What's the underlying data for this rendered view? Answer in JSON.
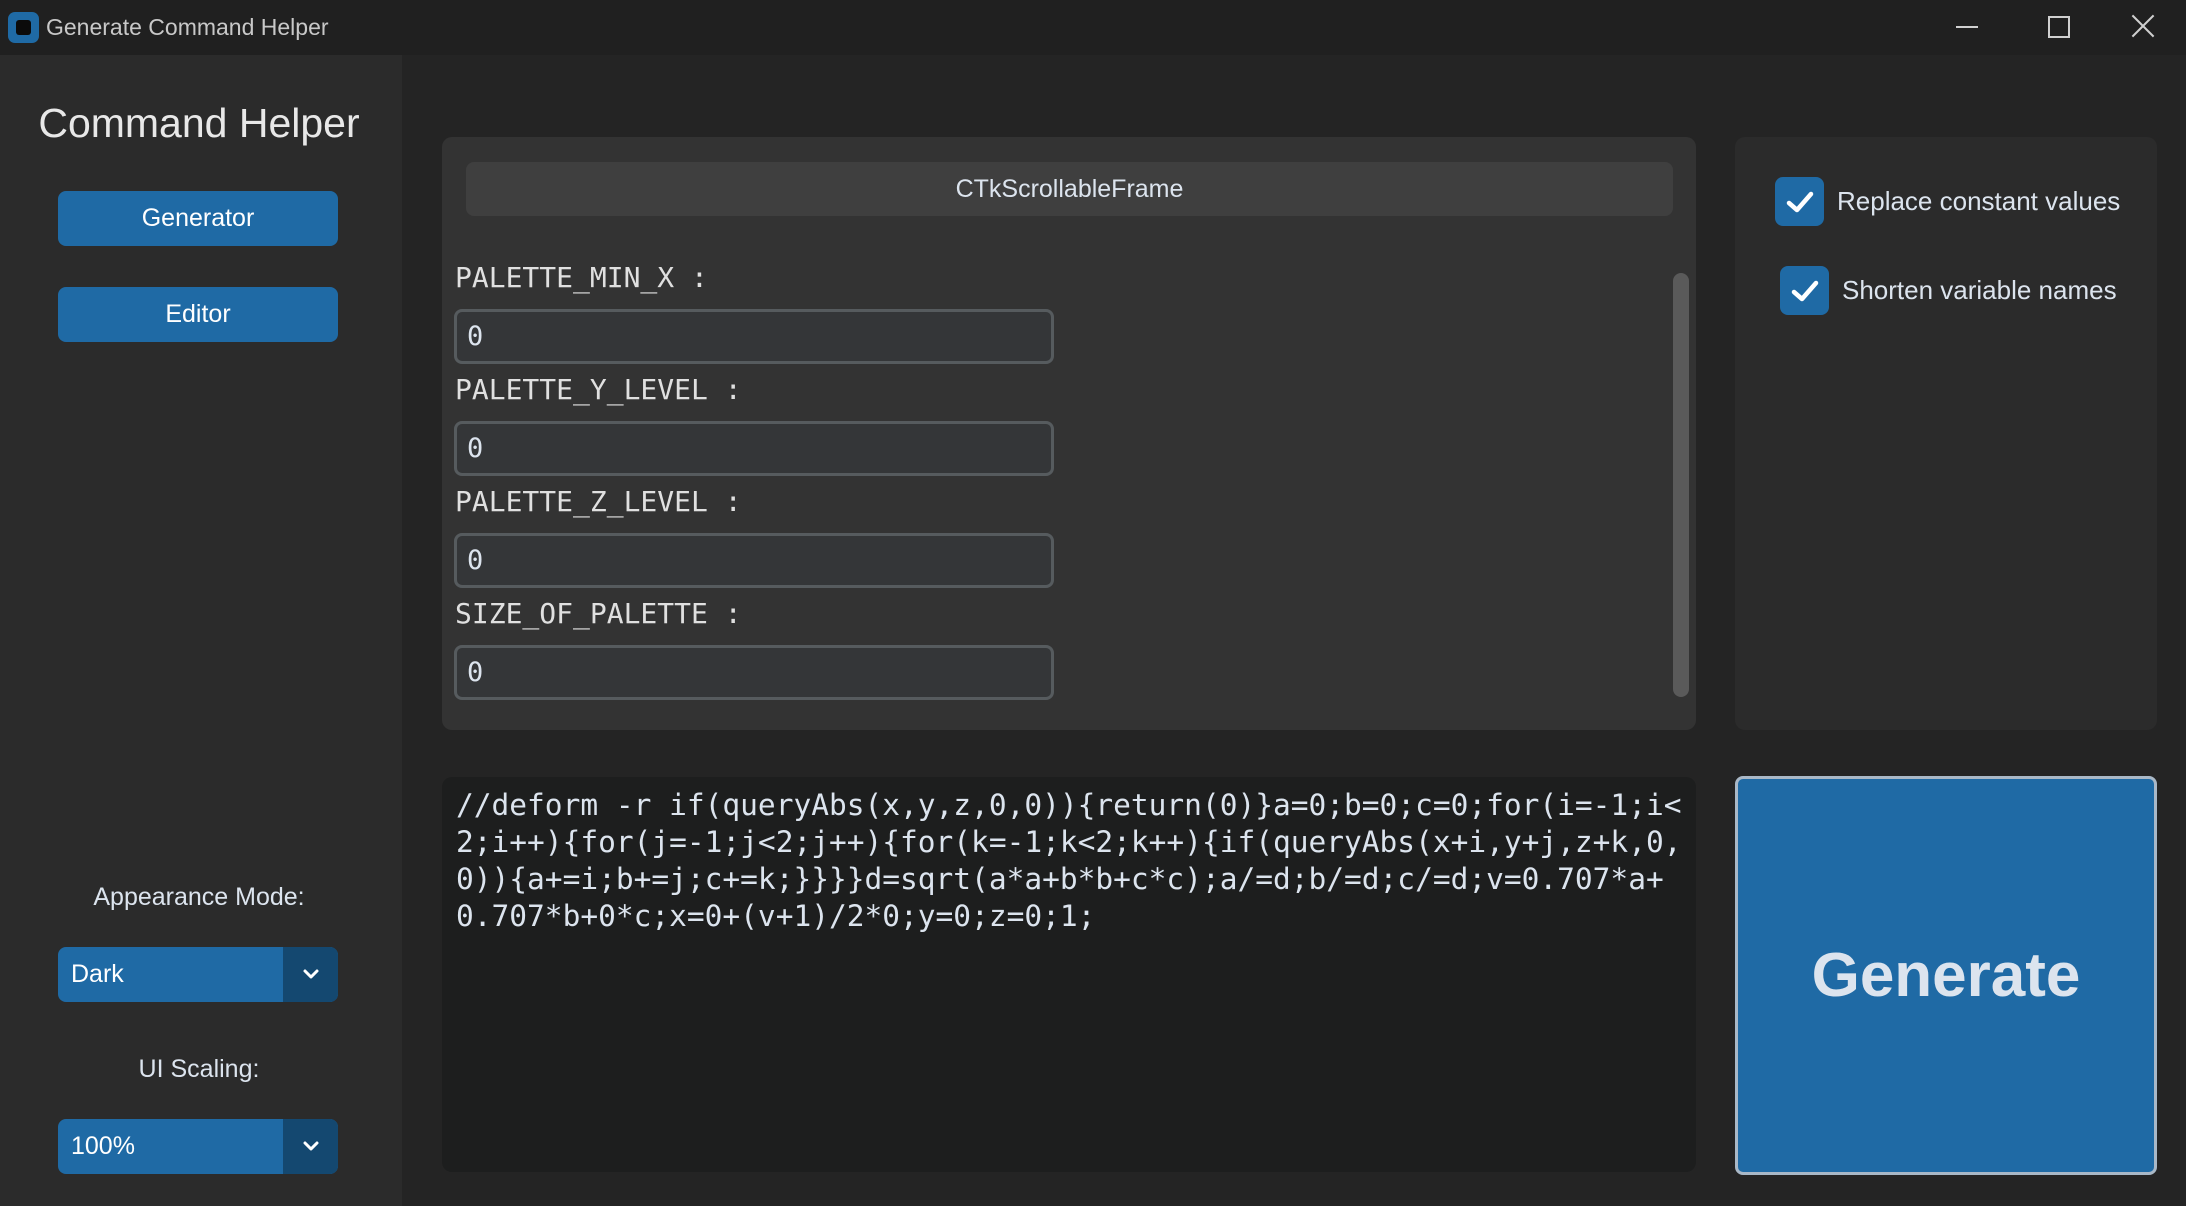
{
  "window": {
    "title": "Generate Command Helper"
  },
  "sidebar": {
    "logo": "Command Helper",
    "nav": {
      "generator": "Generator",
      "editor": "Editor"
    },
    "appearance": {
      "label": "Appearance Mode:",
      "value": "Dark"
    },
    "scaling": {
      "label": "UI Scaling:",
      "value": "100%"
    }
  },
  "scroll_frame": {
    "label": "CTkScrollableFrame",
    "params": [
      {
        "name": "PALETTE_MIN_X :",
        "value": "0"
      },
      {
        "name": "PALETTE_Y_LEVEL :",
        "value": "0"
      },
      {
        "name": "PALETTE_Z_LEVEL :",
        "value": "0"
      },
      {
        "name": "SIZE_OF_PALETTE :",
        "value": "0"
      }
    ]
  },
  "options": {
    "replace_constant": {
      "label": "Replace constant values",
      "checked": true
    },
    "shorten_names": {
      "label": "Shorten variable names",
      "checked": true
    }
  },
  "output": {
    "text": "//deform -r if(queryAbs(x,y,z,0,0)){return(0)}a=0;b=0;c=0;for(i=-1;i<2;i++){for(j=-1;j<2;j++){for(k=-1;k<2;k++){if(queryAbs(x+i,y+j,z+k,0,0)){a+=i;b+=j;c+=k;}}}}d=sqrt(a*a+b*b+c*c);a/=d;b/=d;c/=d;v=0.707*a+0.707*b+0*c;x=0+(v+1)/2*0;y=0;z=0;1;"
  },
  "generate_button": "Generate",
  "colors": {
    "accent": "#1f6aa5",
    "accent_dark": "#144870",
    "background": "#242424",
    "panel": "#2b2b2b"
  }
}
